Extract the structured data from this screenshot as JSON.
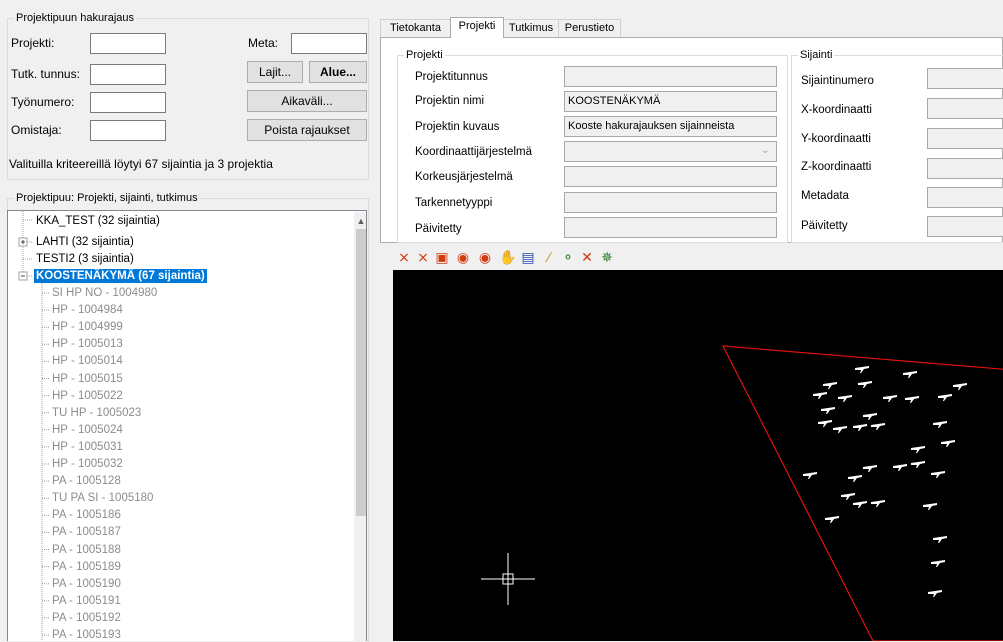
{
  "search": {
    "title": "Projektipuun hakurajaus",
    "labels": {
      "projekti": "Projekti:",
      "tutk_tunnus": "Tutk. tunnus:",
      "tyonumero": "Työnumero:",
      "omistaja": "Omistaja:",
      "meta": "Meta:"
    },
    "buttons": {
      "lajit": "Lajit...",
      "alue": "Alue...",
      "aikavali": "Aikaväli...",
      "poista": "Poista rajaukset"
    },
    "result_text": "Valituilla kriteereillä löytyi 67 sijaintia ja 3 projektia"
  },
  "tree": {
    "title": "Projektipuu: Projekti, sijainti, tutkimus",
    "items": [
      {
        "text": "KKA_TEST (32 sijaintia)"
      },
      {
        "text": "LAHTI (32 sijaintia)"
      },
      {
        "text": "TESTI2 (3 sijaintia)"
      },
      {
        "text": "KOOSTENÄKYMÄ (67 sijaintia)"
      },
      {
        "text": "SI HP NO - 1004980"
      },
      {
        "text": "HP - 1004984"
      },
      {
        "text": "HP - 1004999"
      },
      {
        "text": "HP - 1005013"
      },
      {
        "text": "HP - 1005014"
      },
      {
        "text": "HP - 1005015"
      },
      {
        "text": "HP - 1005022"
      },
      {
        "text": "TU HP - 1005023"
      },
      {
        "text": "HP - 1005024"
      },
      {
        "text": "HP - 1005031"
      },
      {
        "text": "HP - 1005032"
      },
      {
        "text": "PA - 1005128"
      },
      {
        "text": "TU PA SI - 1005180"
      },
      {
        "text": "PA - 1005186"
      },
      {
        "text": "PA - 1005187"
      },
      {
        "text": "PA - 1005188"
      },
      {
        "text": "PA - 1005189"
      },
      {
        "text": "PA - 1005190"
      },
      {
        "text": "PA - 1005191"
      },
      {
        "text": "PA - 1005192"
      },
      {
        "text": "PA - 1005193"
      }
    ]
  },
  "tabs": [
    "Tietokanta",
    "Projekti",
    "Tutkimus",
    "Perustieto"
  ],
  "projekti": {
    "title": "Projekti",
    "fields": [
      {
        "label": "Projektitunnus",
        "value": ""
      },
      {
        "label": "Projektin nimi",
        "value": "KOOSTENÄKYMÄ"
      },
      {
        "label": "Projektin kuvaus",
        "value": "Kooste hakurajauksen sijainneista"
      },
      {
        "label": "Koordinaattijärjestelmä",
        "value": ""
      },
      {
        "label": "Korkeusjärjestelmä",
        "value": ""
      },
      {
        "label": "Tarkennetyyppi",
        "value": ""
      },
      {
        "label": "Päivitetty",
        "value": ""
      }
    ]
  },
  "sijainti": {
    "title": "Sijainti",
    "fields": [
      {
        "label": "Sijaintinumero",
        "value": ""
      },
      {
        "label": "X-koordinaatti",
        "value": ""
      },
      {
        "label": "Y-koordinaatti",
        "value": ""
      },
      {
        "label": "Z-koordinaatti",
        "value": ""
      },
      {
        "label": "Metadata",
        "value": ""
      },
      {
        "label": "Päivitetty",
        "value": ""
      }
    ]
  },
  "toolbar_icons": [
    "zoom-extents-icon",
    "zoom-window-icon",
    "zoom-previous-icon",
    "zoom-in-icon",
    "zoom-out-icon",
    "pan-hand-icon",
    "measure-icon",
    "brush-icon",
    "select-point-icon",
    "cross-line-icon",
    "snap-icon"
  ],
  "colors": {
    "selection": "#0078d7",
    "canvas": "#000000",
    "boundary": "#e01010"
  }
}
